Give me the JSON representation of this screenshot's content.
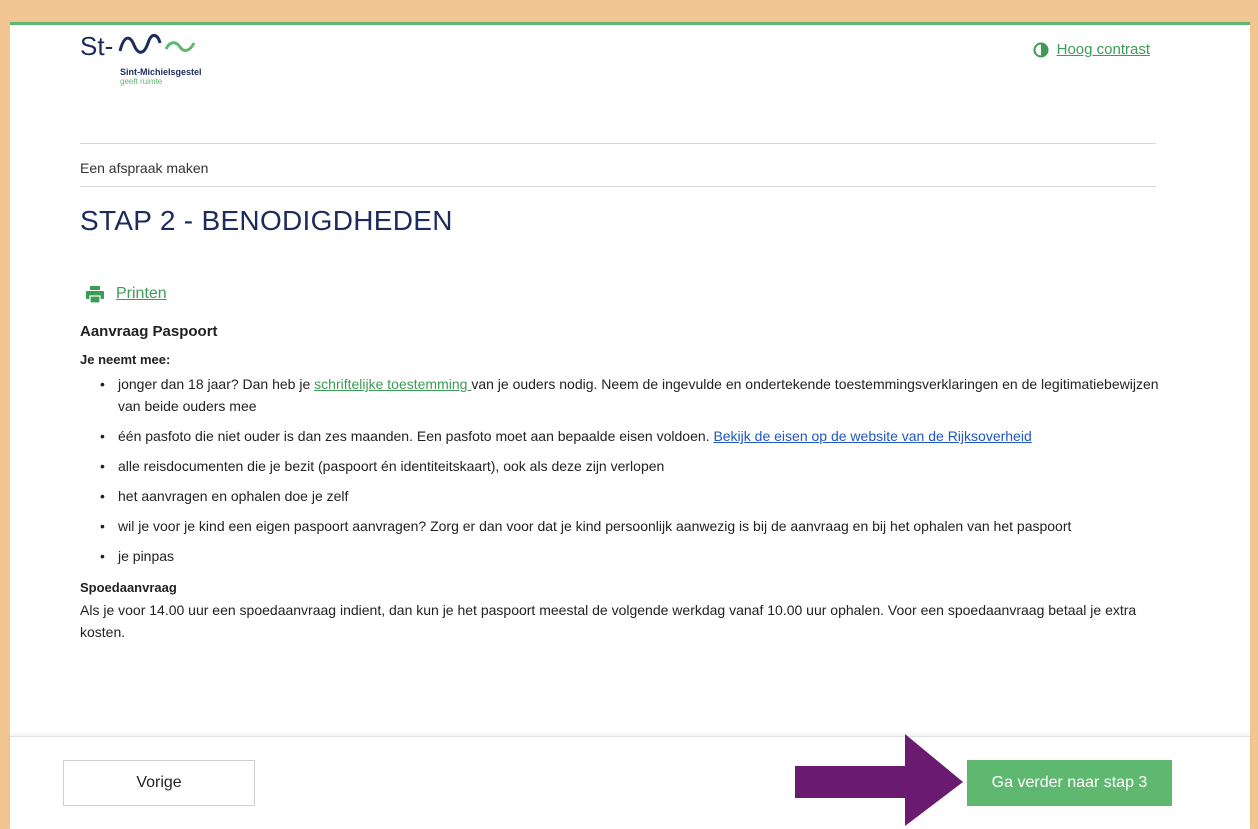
{
  "header": {
    "logo_text": "Sint-Michielsgestel",
    "logo_tagline": "geeft ruimte",
    "contrast_label": "Hoog contrast"
  },
  "breadcrumb": "Een afspraak maken",
  "page_title": "STAP 2 - BENODIGDHEDEN",
  "print_label": "Printen",
  "content": {
    "heading": "Aanvraag Paspoort",
    "subheading": "Je neemt mee:",
    "items": [
      {
        "before": "jonger dan 18 jaar? Dan heb je ",
        "link": "schriftelijke toestemming ",
        "after": "van je ouders nodig.  Neem de ingevulde en ondertekende toestemmingsverklaringen en de legitimatiebewijzen van beide ouders mee"
      },
      {
        "before": "één pasfoto die niet ouder is dan zes maanden. Een pasfoto moet aan bepaalde eisen voldoen. ",
        "link": "Bekijk de eisen op de website van de Rijksoverheid",
        "after": ""
      },
      {
        "text": "alle reisdocumenten die je bezit (paspoort én identiteitskaart), ook als deze zijn verlopen"
      },
      {
        "text": "het aanvragen en ophalen doe je zelf"
      },
      {
        "text": "wil je voor je kind een eigen paspoort aanvragen? Zorg er dan voor dat je kind persoonlijk aanwezig is bij de aanvraag en bij het ophalen van het paspoort"
      },
      {
        "text": "je pinpas"
      }
    ],
    "spoed_heading": "Spoedaanvraag",
    "spoed_text": "Als je voor 14.00 uur een spoedaanvraag indient, dan kun je het paspoort meestal de volgende werkdag vanaf 10.00 uur ophalen. Voor een spoedaanvraag betaal je extra kosten."
  },
  "footer": {
    "prev_label": "Vorige",
    "next_label": "Ga verder naar stap 3"
  },
  "colors": {
    "accent_green": "#5fb870",
    "title_navy": "#1d2a5c",
    "link_blue": "#1f57c3",
    "frame_orange": "#f3c592",
    "arrow_purple": "#6a1b6f"
  },
  "icons": [
    "contrast-icon",
    "printer-icon",
    "logo-wave-icon",
    "arrow-right-icon"
  ]
}
